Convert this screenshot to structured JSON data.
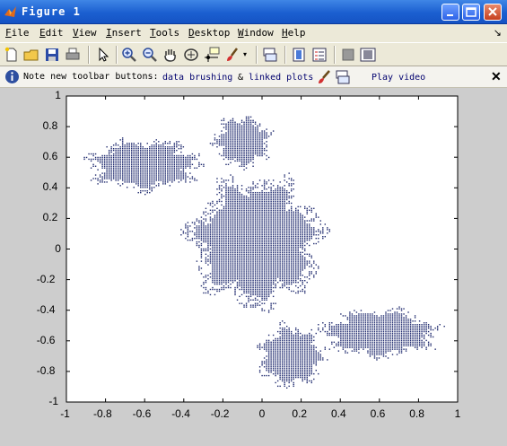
{
  "window": {
    "title": "Figure 1"
  },
  "menu": [
    {
      "key": "F",
      "rest": "ile"
    },
    {
      "key": "E",
      "rest": "dit"
    },
    {
      "key": "V",
      "rest": "iew"
    },
    {
      "key": "I",
      "rest": "nsert"
    },
    {
      "key": "T",
      "rest": "ools"
    },
    {
      "key": "D",
      "rest": "esktop"
    },
    {
      "key": "W",
      "rest": "indow"
    },
    {
      "key": "H",
      "rest": "elp"
    }
  ],
  "toolbar": {
    "buttons": [
      "new-figure",
      "open-file",
      "save",
      "print",
      "edit-plot",
      "zoom-in",
      "zoom-out",
      "pan",
      "rotate-3d",
      "data-cursor",
      "brush",
      "link-plot",
      "insert-colorbar",
      "insert-legend",
      "hide-plot-tools",
      "show-plot-tools"
    ]
  },
  "note": {
    "text": "Note new toolbar buttons:",
    "link1": "data brushing",
    "amp": "&",
    "link2": "linked plots",
    "link3": "Play video"
  },
  "colors": {
    "title_bar": "#1b5fd0",
    "marker": "#1f2a6e",
    "figure_bg": "#cdcdcd"
  },
  "chart_data": {
    "type": "scatter",
    "title": "",
    "xlabel": "",
    "ylabel": "",
    "xlim": [
      -1,
      1
    ],
    "ylim": [
      -1,
      1
    ],
    "xticks": [
      "-1",
      "-0.8",
      "-0.6",
      "-0.4",
      "-0.2",
      "0",
      "0.2",
      "0.4",
      "0.6",
      "0.8",
      "1"
    ],
    "yticks": [
      "1",
      "0.8",
      "0.6",
      "0.4",
      "0.2",
      "0",
      "-0.2",
      "-0.4",
      "-0.6",
      "-0.8",
      "-1"
    ],
    "grid": false,
    "marker": "dot",
    "regions": [
      {
        "name": "central-lobe",
        "cx": -0.03,
        "cy": 0.05,
        "rx": 0.3,
        "ry": 0.38
      },
      {
        "name": "top-lobe",
        "cx": -0.1,
        "cy": 0.7,
        "rx": 0.13,
        "ry": 0.15
      },
      {
        "name": "top-left-lobe",
        "cx": -0.6,
        "cy": 0.55,
        "rx": 0.26,
        "ry": 0.15
      },
      {
        "name": "bottom-right-lobe",
        "cx": 0.6,
        "cy": -0.55,
        "rx": 0.27,
        "ry": 0.14
      },
      {
        "name": "bottom-lobe",
        "cx": 0.15,
        "cy": -0.7,
        "rx": 0.15,
        "ry": 0.18
      }
    ]
  }
}
